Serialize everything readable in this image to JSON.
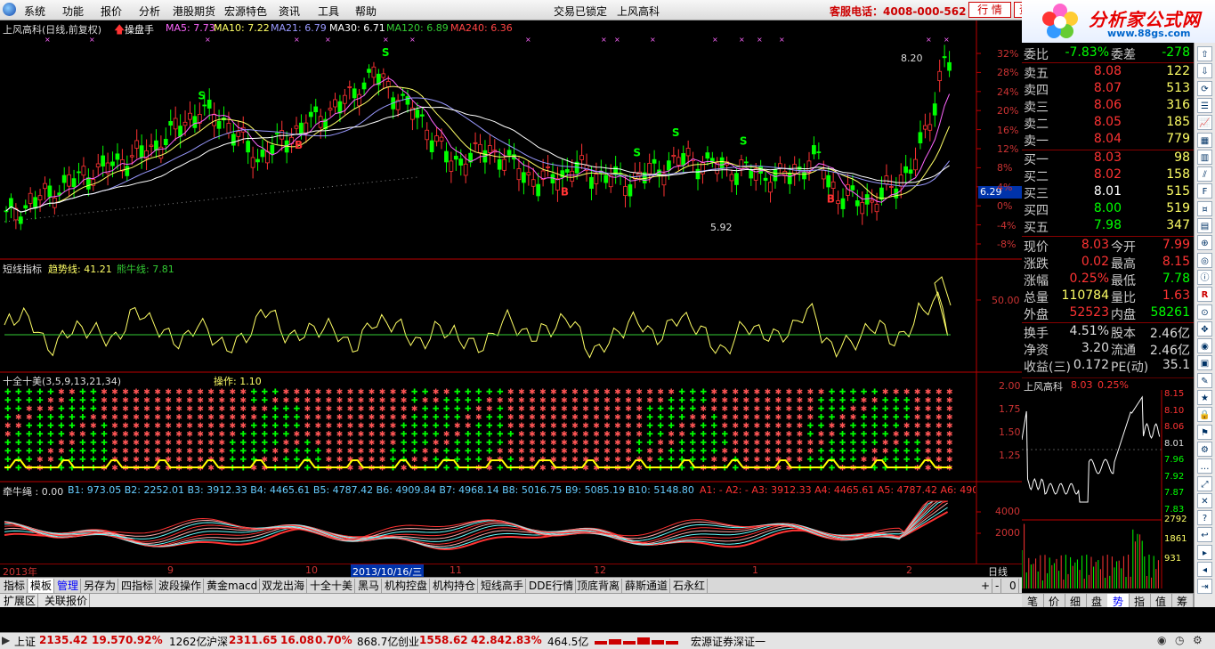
{
  "menu": {
    "items": [
      "系统",
      "功能",
      "报价",
      "分析",
      "港股期货",
      "宏源特色",
      "资讯",
      "工具",
      "帮助"
    ],
    "lock_status": "交易已锁定",
    "stock_name": "上风高科",
    "hotline": "客服电话：4008-000-562",
    "btn_quote": "行  情",
    "btn_asset": "资",
    "colors": {
      "up": "#ff3333",
      "down": "#00ff00",
      "ma5": "#ffffff",
      "ma10": "#ffff00",
      "ma21": "#ff00ff"
    }
  },
  "brand": {
    "title": "分析家公式网",
    "url": "www.88gs.com"
  },
  "main_chart": {
    "title": "上风高科(日线,前复权)",
    "tool": "操盘手",
    "ma": [
      {
        "label": "MA5: 7.73",
        "color": "#ff66ff"
      },
      {
        "label": "MA10: 7.22",
        "color": "#ffff66"
      },
      {
        "label": "MA21: 6.79",
        "color": "#9999ff"
      },
      {
        "label": "MA30: 6.71",
        "color": "#ffffff"
      },
      {
        "label": "MA120: 6.89",
        "color": "#33cc33"
      },
      {
        "label": "MA240: 6.36",
        "color": "#ff4444"
      }
    ],
    "high_label": "8.20",
    "low_label": "5.92",
    "current_price": "6.29",
    "y_ticks": [
      "32%",
      "28%",
      "24%",
      "20%",
      "16%",
      "12%",
      "8%",
      "4%",
      "0%",
      "-4%",
      "-8%"
    ]
  },
  "short_ind": {
    "title": "短线指标",
    "trend": "趋势线: 41.21",
    "bear": "熊牛线: 7.81",
    "y_tick": "50.00"
  },
  "ten_ind": {
    "title": "十全十美(3,5,9,13,21,34)",
    "op": "操作: 1.10",
    "y_ticks": [
      "2.00",
      "1.75",
      "1.50",
      "1.25"
    ]
  },
  "rope_ind": {
    "title": "牵牛绳 : 0.00",
    "values": "B1: 973.05  B2: 2252.01  B3: 3912.33  B4: 4465.61  B5: 4787.42  B6: 4909.84  B7: 4968.14  B8: 5016.75  B9: 5085.19  B10: 5148.80",
    "values_a": "A1: -   A2: -   A3: 3912.33  A4: 4465.61  A5: 4787.42  A6: 490",
    "y_ticks": [
      "4000",
      "2000"
    ]
  },
  "date_axis": {
    "year": "2013年",
    "months": [
      "9",
      "10",
      "11",
      "12",
      "1",
      "2"
    ],
    "cursor_date": "2013/10/16/三",
    "period": "日线"
  },
  "quote": {
    "committee_ratio_label": "委比",
    "committee_ratio": "-7.83%",
    "committee_diff_label": "委差",
    "committee_diff": "-278",
    "sells": [
      {
        "name": "卖五",
        "price": "8.08",
        "vol": "122"
      },
      {
        "name": "卖四",
        "price": "8.07",
        "vol": "513"
      },
      {
        "name": "卖三",
        "price": "8.06",
        "vol": "316"
      },
      {
        "name": "卖二",
        "price": "8.05",
        "vol": "185"
      },
      {
        "name": "卖一",
        "price": "8.04",
        "vol": "779"
      }
    ],
    "buys": [
      {
        "name": "买一",
        "price": "8.03",
        "vol": "98"
      },
      {
        "name": "买二",
        "price": "8.02",
        "vol": "158"
      },
      {
        "name": "买三",
        "price": "8.01",
        "vol": "515"
      },
      {
        "name": "买四",
        "price": "8.00",
        "vol": "519"
      },
      {
        "name": "买五",
        "price": "7.98",
        "vol": "347"
      }
    ],
    "stats": [
      {
        "l1": "现价",
        "v1": "8.03",
        "l2": "今开",
        "v2": "7.99"
      },
      {
        "l1": "涨跌",
        "v1": "0.02",
        "l2": "最高",
        "v2": "8.15"
      },
      {
        "l1": "涨幅",
        "v1": "0.25%",
        "l2": "最低",
        "v2": "7.78"
      },
      {
        "l1": "总量",
        "v1": "110784",
        "l2": "量比",
        "v2": "1.63"
      },
      {
        "l1": "外盘",
        "v1": "52523",
        "l2": "内盘",
        "v2": "58261"
      }
    ],
    "stats2": [
      {
        "l1": "换手",
        "v1": "4.51%",
        "l2": "股本",
        "v2": "2.46亿"
      },
      {
        "l1": "净资",
        "v1": "3.20",
        "l2": "流通",
        "v2": "2.46亿"
      },
      {
        "l1": "收益(三)",
        "v1": "0.172",
        "l2": "PE(动)",
        "v2": "35.1"
      }
    ]
  },
  "mini_chart": {
    "title": "上风高科",
    "price": "8.03",
    "pct": "0.25%",
    "y_ticks": [
      "8.15",
      "8.10",
      "8.06",
      "8.01",
      "7.96",
      "7.92",
      "7.87",
      "7.83"
    ],
    "vol_ticks": [
      "2792",
      "1861",
      "931"
    ]
  },
  "mini_tabs": [
    "笔",
    "价",
    "细",
    "盘",
    "势",
    "指",
    "值",
    "筹"
  ],
  "tabs": [
    "指标",
    "模板",
    "管理",
    "另存为",
    "四指标",
    "波段操作",
    "黄金macd",
    "双龙出海",
    "十全十美",
    "黑马",
    "机构控盘",
    "机构持仓",
    "短线高手",
    "DDE行情",
    "顶底背离",
    "薛斯通道",
    "石永红"
  ],
  "tabs2": [
    "扩展区",
    "关联报价"
  ],
  "tab_controls": [
    "+",
    "-",
    "0"
  ],
  "status": {
    "sh_label": "上证",
    "sh_val": "2135.42",
    "sh_chg": "19.57",
    "sh_pct": "0.92%",
    "sh_amt": "1262亿",
    "sz_label": "沪深",
    "sz_val": "2311.65",
    "sz_chg": "16.08",
    "sz_pct": "0.70%",
    "sz_amt": "868.7亿",
    "cy_label": "创业",
    "cy_val": "1558.62",
    "cy_chg": "42.84",
    "cy_pct": "2.83%",
    "cy_amt": "464.5亿",
    "broker": "宏源证券深证一"
  }
}
